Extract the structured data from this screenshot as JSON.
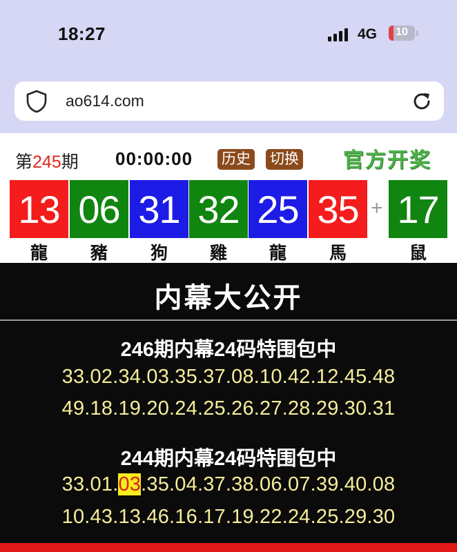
{
  "status_bar": {
    "time": "18:27",
    "network": "4G",
    "battery": "10",
    "battery_color": "#e04343"
  },
  "browser": {
    "url": "ao614.com",
    "security_icon": "shield-icon",
    "reload_icon": "reload-icon"
  },
  "draw_header": {
    "issue_prefix": "第",
    "issue_number": "245",
    "issue_suffix": "期",
    "timer": "00:00:00",
    "history_label": "历史",
    "switch_label": "切换",
    "official_label": "官方开奖"
  },
  "balls": [
    {
      "number": "13",
      "zodiac": "龍",
      "color": "red"
    },
    {
      "number": "06",
      "zodiac": "豬",
      "color": "green"
    },
    {
      "number": "31",
      "zodiac": "狗",
      "color": "blue"
    },
    {
      "number": "32",
      "zodiac": "雞",
      "color": "green"
    },
    {
      "number": "25",
      "zodiac": "龍",
      "color": "blue"
    },
    {
      "number": "35",
      "zodiac": "馬",
      "color": "red"
    }
  ],
  "plus_sign": "+",
  "special_ball": {
    "number": "17",
    "zodiac": "鼠",
    "color": "green"
  },
  "panel": {
    "title": "内幕大公开",
    "blocks": [
      {
        "heading": "246期内幕24码特围包中",
        "line1": "33.02.34.03.35.37.08.10.42.12.45.48",
        "line2": "49.18.19.20.24.25.26.27.28.29.30.31"
      },
      {
        "heading": "244期内幕24码特围包中",
        "line1_before": "33.01.",
        "line1_hit": "03",
        "line1_after": ".35.04.37.38.06.07.39.40.08",
        "line2": "10.43.13.46.16.17.19.22.24.25.29.30"
      }
    ]
  }
}
